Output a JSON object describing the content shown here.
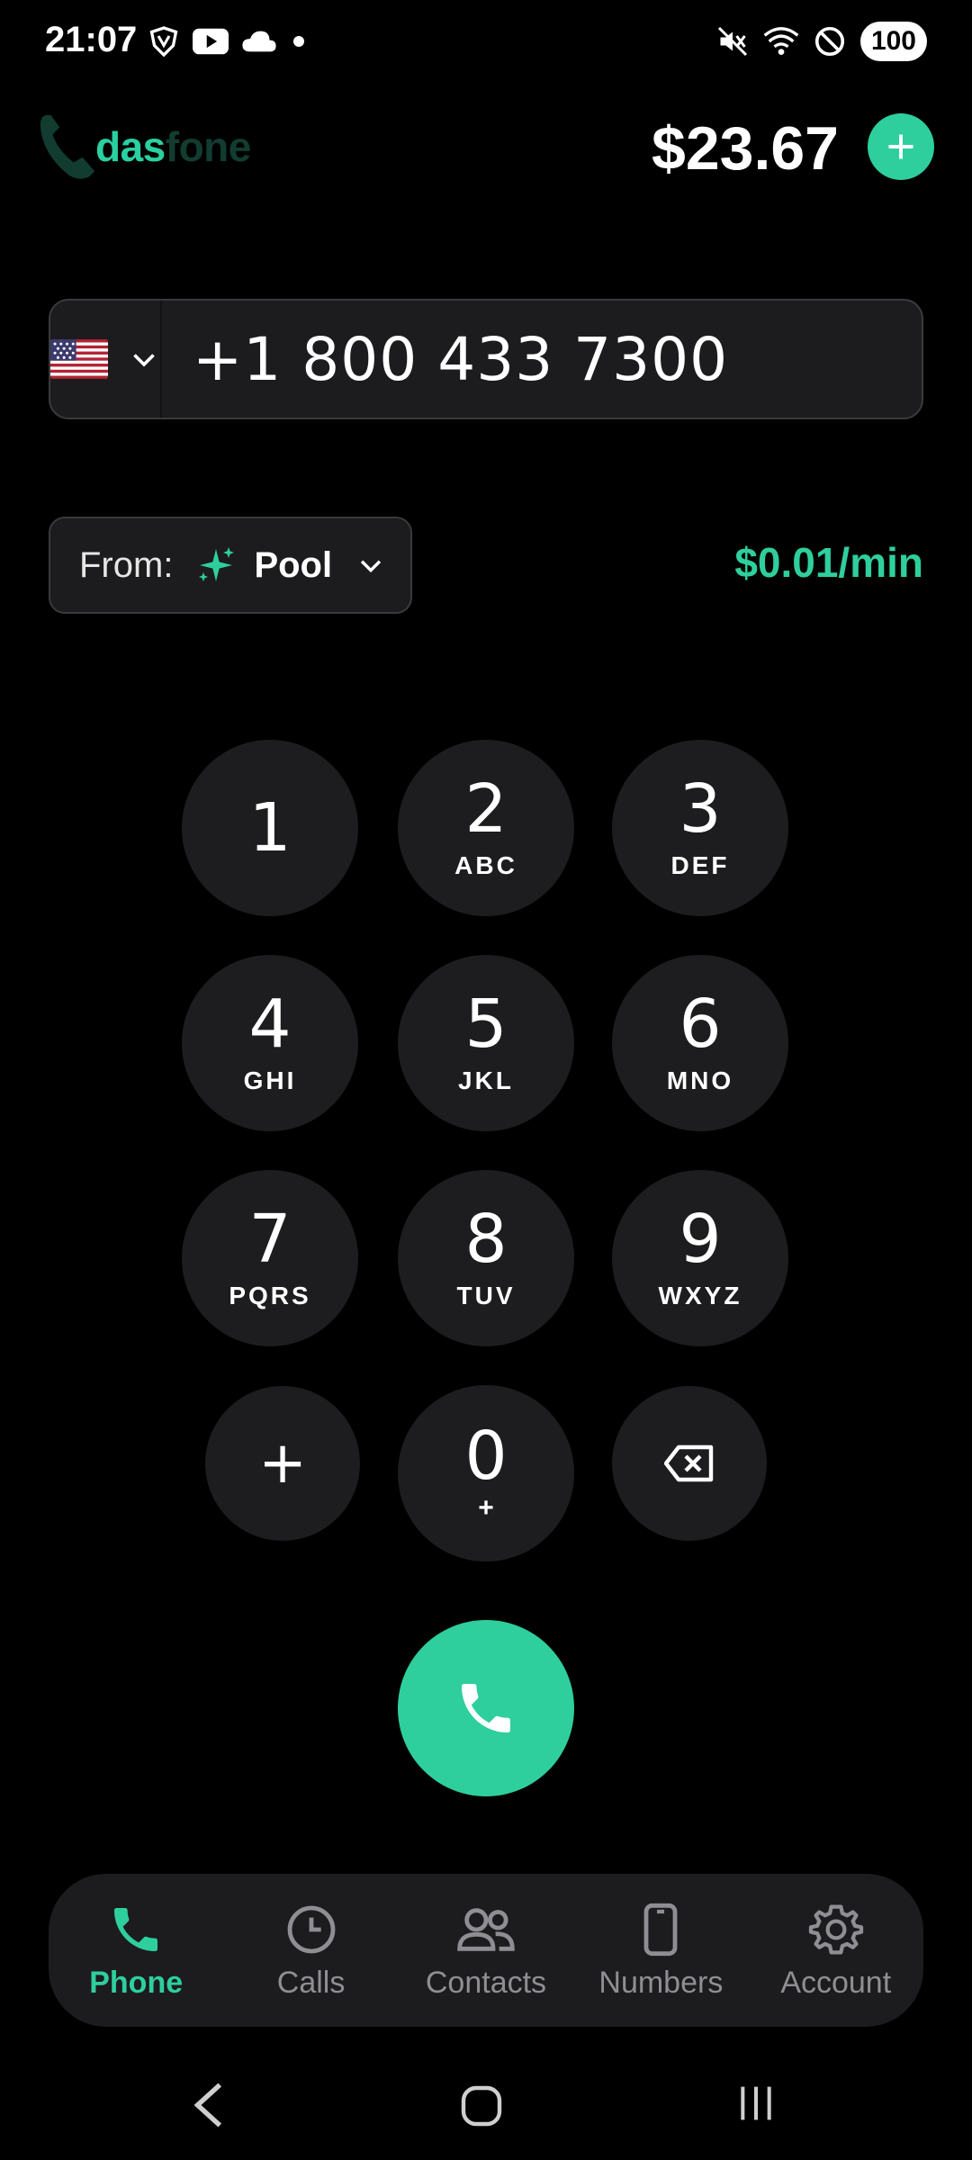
{
  "status_bar": {
    "time": "21:07",
    "battery": "100",
    "icons_left": [
      "vpn-shield-icon",
      "youtube-icon",
      "cloud-icon",
      "dot-icon"
    ],
    "icons_right": [
      "mute-vibrate-icon",
      "wifi-icon",
      "do-not-disturb-icon",
      "battery-icon"
    ]
  },
  "header": {
    "logo_part1": "das",
    "logo_part2": "fone",
    "balance": "$23.67",
    "add_icon": "plus-icon"
  },
  "dialer": {
    "country_flag": "us-flag-icon",
    "phone_number": "+1 800 433 7300",
    "from_label": "From:",
    "from_value": "Pool",
    "rate": "$0.01/min"
  },
  "keypad": {
    "keys": [
      {
        "digit": "1",
        "letters": ""
      },
      {
        "digit": "2",
        "letters": "ABC"
      },
      {
        "digit": "3",
        "letters": "DEF"
      },
      {
        "digit": "4",
        "letters": "GHI"
      },
      {
        "digit": "5",
        "letters": "JKL"
      },
      {
        "digit": "6",
        "letters": "MNO"
      },
      {
        "digit": "7",
        "letters": "PQRS"
      },
      {
        "digit": "8",
        "letters": "TUV"
      },
      {
        "digit": "9",
        "letters": "WXYZ"
      },
      {
        "digit": "0",
        "letters": "+"
      }
    ],
    "plus_key": "+",
    "backspace_icon": "backspace-icon",
    "call_icon": "phone-icon"
  },
  "bottom_nav": {
    "items": [
      {
        "label": "Phone",
        "icon": "phone-icon",
        "active": true
      },
      {
        "label": "Calls",
        "icon": "clock-icon",
        "active": false
      },
      {
        "label": "Contacts",
        "icon": "people-icon",
        "active": false
      },
      {
        "label": "Numbers",
        "icon": "smartphone-icon",
        "active": false
      },
      {
        "label": "Account",
        "icon": "gear-icon",
        "active": false
      }
    ]
  },
  "colors": {
    "accent": "#2ecf9d",
    "background": "#000000",
    "surface": "#1c1c1e",
    "inactive": "#8e8e93"
  }
}
